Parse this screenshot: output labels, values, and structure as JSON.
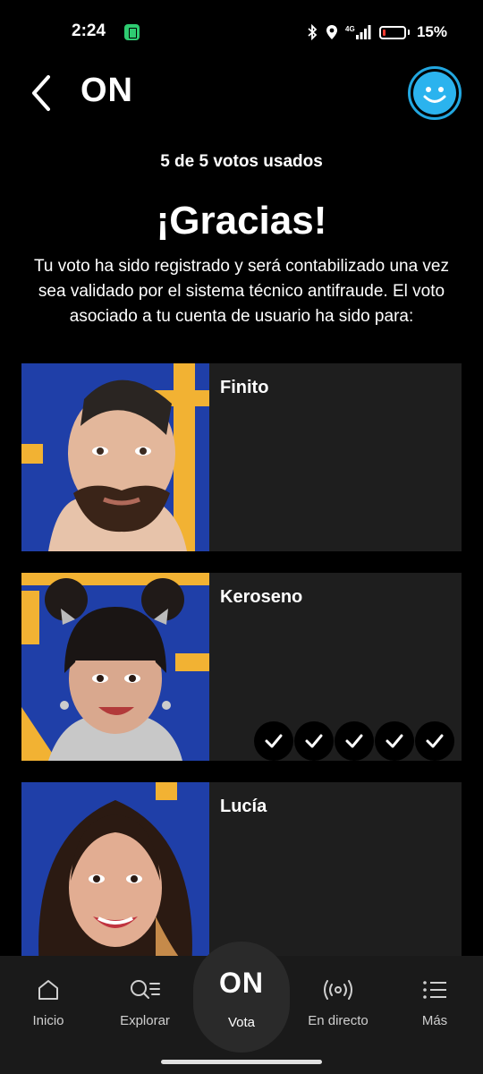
{
  "status_bar": {
    "time": "2:24",
    "network": "4G",
    "battery": "15%",
    "battery_level": 0.15,
    "battery_color": "#ff3b30"
  },
  "header": {
    "title": "ON",
    "back_icon": "chevron-left-icon",
    "profile_icon": "smiley-icon",
    "accent": "#2bb3ee"
  },
  "vote": {
    "votes_used": "5 de 5 votos usados",
    "thanks_title": "¡Gracias!",
    "thanks_body": "Tu voto ha sido registrado y será contabilizado una vez sea validado por el sistema técnico antifraude. El voto asociado a tu cuenta de usuario ha sido para:"
  },
  "candidates": [
    {
      "name": "Finito",
      "votes": 0
    },
    {
      "name": "Keroseno",
      "votes": 5
    },
    {
      "name": "Lucía",
      "votes": 0
    }
  ],
  "nav": {
    "items": [
      {
        "label": "Inicio",
        "icon": "home-icon"
      },
      {
        "label": "Explorar",
        "icon": "search-list-icon"
      },
      {
        "label": "Vota",
        "icon": "on-logo"
      },
      {
        "label": "En directo",
        "icon": "broadcast-icon"
      },
      {
        "label": "Más",
        "icon": "menu-icon"
      }
    ],
    "center_logo": "ON"
  }
}
